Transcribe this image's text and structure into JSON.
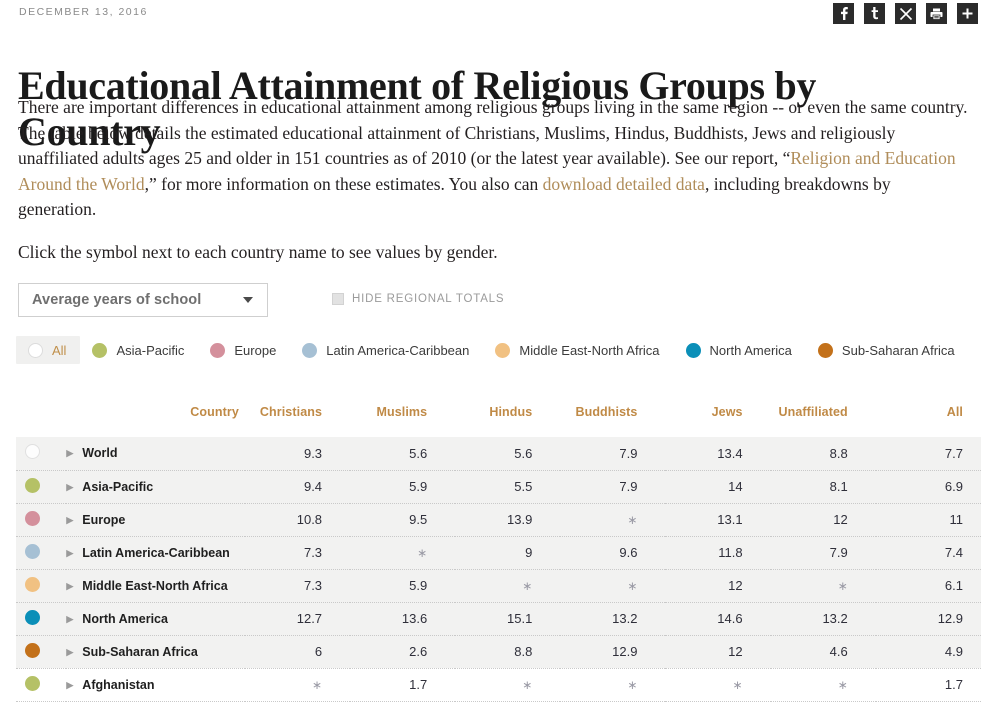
{
  "header": {
    "date": "DECEMBER 13, 2016",
    "social_icons": [
      {
        "name": "facebook-icon",
        "glyph": "f"
      },
      {
        "name": "twitter-icon",
        "glyph": "t"
      },
      {
        "name": "email-icon",
        "glyph": "✕"
      },
      {
        "name": "print-icon",
        "glyph": "⎙"
      },
      {
        "name": "share-more-icon",
        "glyph": "+"
      }
    ]
  },
  "title": "Educational Attainment of Religious Groups by Country",
  "intro": {
    "p1_a": "There are important differences in educational attainment among religious groups living in the same region -- or even the same country. The table below details the estimated educational attainment of Christians, Muslims, Hindus, Buddhists, Jews and religiously unaffiliated adults ages 25 and older in 151 countries as of 2010 (or the latest year available). See our report, “",
    "link1": "Religion and Education Around the World",
    "p1_b": ",” for more information on these estimates. You also can ",
    "link2": "download detailed data",
    "p1_c": ", including breakdowns by generation.",
    "p2": "Click the symbol next to each country name to see values by gender."
  },
  "controls": {
    "metric_selected": "Average years of school",
    "hide_regional_totals_label": "HIDE REGIONAL TOTALS",
    "hide_regional_totals_checked": false
  },
  "legend": [
    {
      "label": "All",
      "color": "hollow",
      "active": true
    },
    {
      "label": "Asia-Pacific",
      "color": "#b5c166",
      "active": false
    },
    {
      "label": "Europe",
      "color": "#d4909c",
      "active": false
    },
    {
      "label": "Latin America-Caribbean",
      "color": "#a6c0d4",
      "active": false
    },
    {
      "label": "Middle East-North Africa",
      "color": "#f1c182",
      "active": false
    },
    {
      "label": "North America",
      "color": "#0b8fb8",
      "active": false
    },
    {
      "label": "Sub-Saharan Africa",
      "color": "#c3711a",
      "active": false
    }
  ],
  "table": {
    "columns": [
      "Country",
      "Christians",
      "Muslims",
      "Hindus",
      "Buddhists",
      "Jews",
      "Unaffiliated",
      "All"
    ],
    "rows": [
      {
        "country": "World",
        "color": "hollow",
        "shaded": true,
        "values": [
          "9.3",
          "5.6",
          "5.6",
          "7.9",
          "13.4",
          "8.8",
          "7.7"
        ]
      },
      {
        "country": "Asia-Pacific",
        "color": "#b5c166",
        "shaded": true,
        "values": [
          "9.4",
          "5.9",
          "5.5",
          "7.9",
          "14",
          "8.1",
          "6.9"
        ]
      },
      {
        "country": "Europe",
        "color": "#d4909c",
        "shaded": true,
        "values": [
          "10.8",
          "9.5",
          "13.9",
          "*",
          "13.1",
          "12",
          "11"
        ]
      },
      {
        "country": "Latin America-Caribbean",
        "color": "#a6c0d4",
        "shaded": true,
        "values": [
          "7.3",
          "*",
          "9",
          "9.6",
          "11.8",
          "7.9",
          "7.4"
        ]
      },
      {
        "country": "Middle East-North Africa",
        "color": "#f1c182",
        "shaded": true,
        "values": [
          "7.3",
          "5.9",
          "*",
          "*",
          "12",
          "*",
          "6.1"
        ]
      },
      {
        "country": "North America",
        "color": "#0b8fb8",
        "shaded": true,
        "values": [
          "12.7",
          "13.6",
          "15.1",
          "13.2",
          "14.6",
          "13.2",
          "12.9"
        ]
      },
      {
        "country": "Sub-Saharan Africa",
        "color": "#c3711a",
        "shaded": true,
        "values": [
          "6",
          "2.6",
          "8.8",
          "12.9",
          "12",
          "4.6",
          "4.9"
        ]
      },
      {
        "country": "Afghanistan",
        "color": "#b5c166",
        "shaded": false,
        "values": [
          "*",
          "1.7",
          "*",
          "*",
          "*",
          "*",
          "1.7"
        ]
      }
    ]
  },
  "colors": {
    "accent": "#c08a46",
    "link": "#b08d5a"
  }
}
